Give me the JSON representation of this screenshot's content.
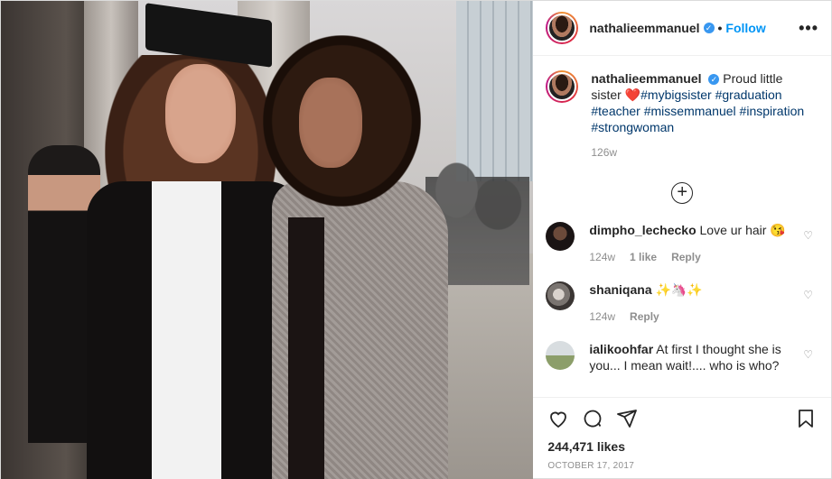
{
  "post": {
    "username": "nathalieemmanuel",
    "verified_symbol": "✓",
    "separator": "•",
    "follow_label": "Follow",
    "more_label": "•••"
  },
  "caption": {
    "username": "nathalieemmanuel",
    "text_before": "Proud little sister",
    "heart": "❤️",
    "hashtags": "#mybigsister #graduation #teacher #missemmanuel #inspiration #strongwoman",
    "time": "126w"
  },
  "comments": [
    {
      "username": "dimpho_lechecko",
      "text": "Love ur hair 😘",
      "time": "124w",
      "likes": "1 like",
      "reply": "Reply"
    },
    {
      "username": "shaniqana",
      "text": "✨🦄✨",
      "time": "124w",
      "reply": "Reply"
    },
    {
      "username": "ialikoohfar",
      "text": "At first I thought she is you... I mean wait!.... who is who?"
    }
  ],
  "expand_symbol": "+",
  "likes": "244,471 likes",
  "date": "OCTOBER 17, 2017",
  "colors": {
    "link": "#0095f6",
    "hashtag": "#00376b",
    "muted": "#8e8e8e",
    "heart": "#e0245e"
  }
}
